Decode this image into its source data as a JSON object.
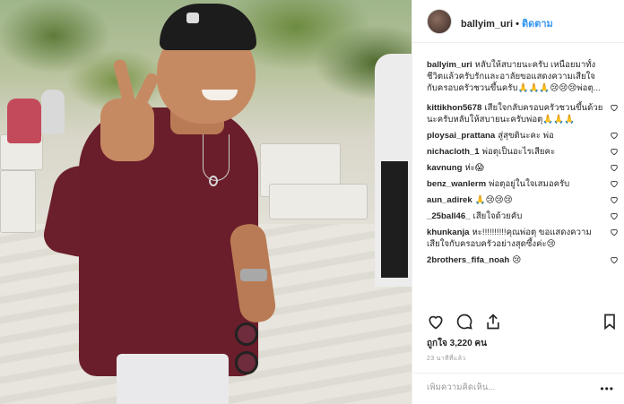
{
  "post": {
    "username": "ballyim_uri",
    "separator": "•",
    "follow_label": "ติดตาม"
  },
  "caption": {
    "username": "ballyim_uri",
    "text": "หลับให้สบายนะครับ เหนื่อยมาทั้งชีวิตแล้วครับรักและอาลัยขอแสดงความเสียใจกับครอบครัวชวนขึ้นครับ🙏🙏🙏😢😢😢พ่อตุ..."
  },
  "comments": [
    {
      "username": "kittikhon5678",
      "text": "เสียใจกลับครอบครัวชวนขึ้นด้วยนะครับหลับให้สบายนะครับพ่อตุ🙏🙏🙏"
    },
    {
      "username": "ploysai_prattana",
      "text": "สู่สุขตินะคะ พ่อ"
    },
    {
      "username": "nichacloth_1",
      "text": "พ่อตุเป็นอะไรเสียคะ"
    },
    {
      "username": "kavnung",
      "text": "ห่ะ😱"
    },
    {
      "username": "benz_wanlerm",
      "text": "พ่อตุอยู่ในใจเสมอครับ"
    },
    {
      "username": "aun_adirek",
      "text": "🙏😢😢😢"
    },
    {
      "username": "_25ball46_",
      "text": "เสียใจด้วยคับ"
    },
    {
      "username": "khunkanja",
      "text": "หะ!!!!!!!!!!คุณพ่อตุ ขอแสดงความเสียใจกับครอบครัวอย่างสุดซึ้งค่ะ😢"
    },
    {
      "username": "2brothers_fifa_noah",
      "text": "😢"
    }
  ],
  "likes": {
    "label": "ถูกใจ 3,220 คน"
  },
  "time_ago": "23 นาทีที่แล้ว",
  "add_comment": {
    "placeholder": "เพิ่มความคิดเห็น...",
    "more": "•••"
  }
}
